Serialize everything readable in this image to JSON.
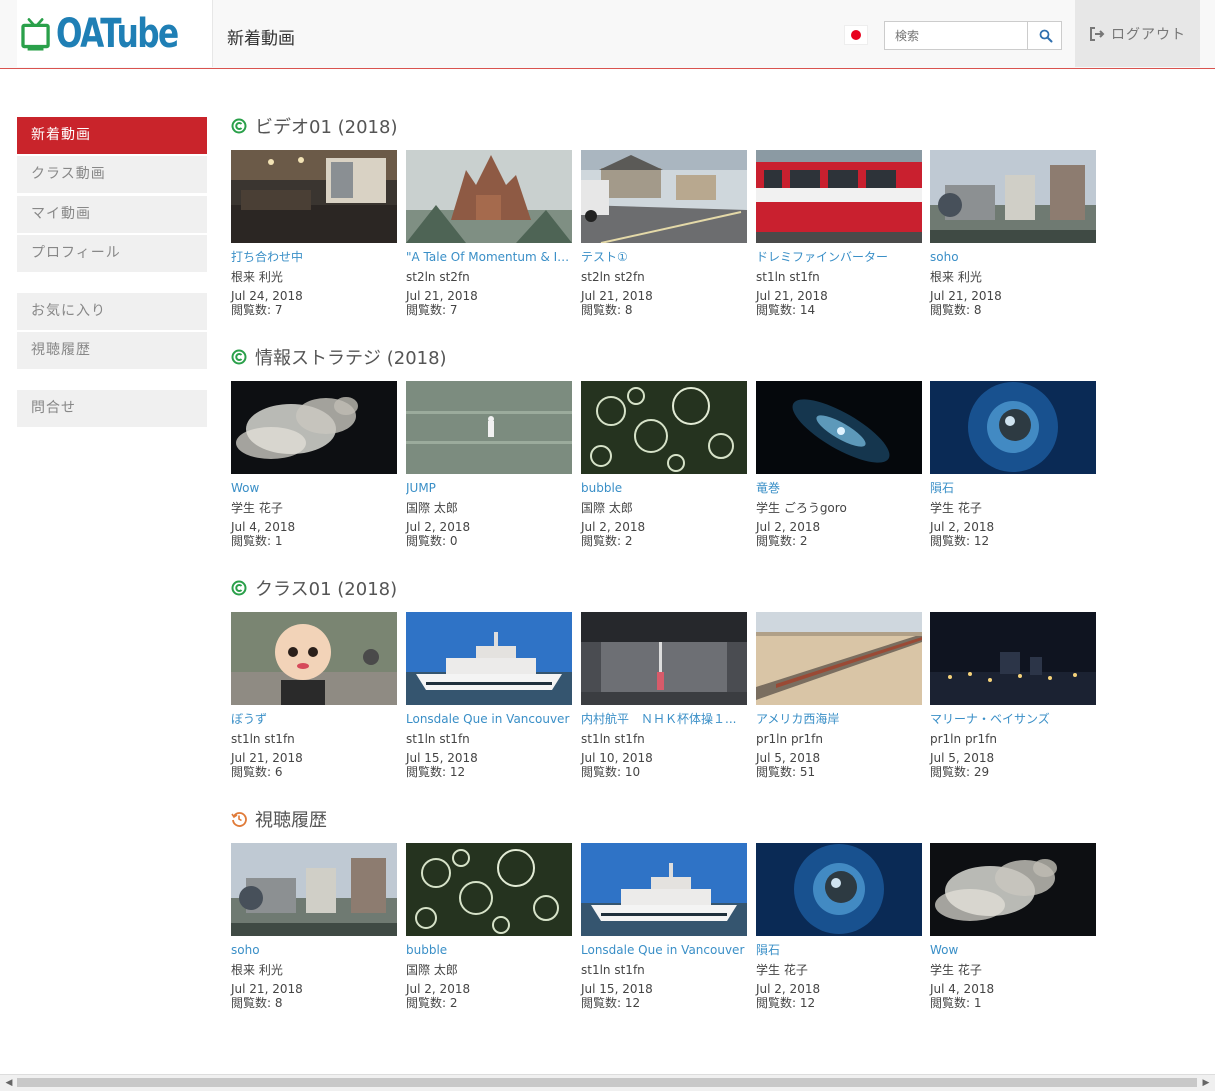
{
  "header": {
    "logo_text": "OATube",
    "page_title": "新着動画",
    "search_placeholder": "検索",
    "logout_label": "ログアウト"
  },
  "sidebar": {
    "group1": [
      "新着動画",
      "クラス動画",
      "マイ動画",
      "プロフィール"
    ],
    "group2": [
      "お気に入り",
      "視聴履歴"
    ],
    "group3": [
      "問合せ"
    ]
  },
  "sections": [
    {
      "title": "ビデオ01 (2018)",
      "icon": "copyright-circle-icon",
      "videos": [
        {
          "title": "打ち合わせ中",
          "author": "根来 利光",
          "date": "Jul 24, 2018",
          "views": "閲覧数: 7",
          "thumb": "cafe-interior"
        },
        {
          "title": "\"A Tale Of Momentum & In...",
          "author": "st2ln st2fn",
          "date": "Jul 21, 2018",
          "views": "閲覧数: 7",
          "thumb": "castle"
        },
        {
          "title": "テスト①",
          "author": "st2ln st2fn",
          "date": "Jul 21, 2018",
          "views": "閲覧数: 8",
          "thumb": "street"
        },
        {
          "title": "ドレミファインバーター",
          "author": "st1ln st1fn",
          "date": "Jul 21, 2018",
          "views": "閲覧数: 14",
          "thumb": "red-train"
        },
        {
          "title": "soho",
          "author": "根来 利光",
          "date": "Jul 21, 2018",
          "views": "閲覧数: 8",
          "thumb": "buildings"
        }
      ]
    },
    {
      "title": "情報ストラテジ (2018)",
      "icon": "copyright-circle-icon",
      "videos": [
        {
          "title": "Wow",
          "author": "学生 花子",
          "date": "Jul 4, 2018",
          "views": "閲覧数: 1",
          "thumb": "smoke"
        },
        {
          "title": "JUMP",
          "author": "国際 太郎",
          "date": "Jul 2, 2018",
          "views": "閲覧数: 0",
          "thumb": "water"
        },
        {
          "title": "bubble",
          "author": "国際 太郎",
          "date": "Jul 2, 2018",
          "views": "閲覧数: 2",
          "thumb": "bubbles"
        },
        {
          "title": "竜巻",
          "author": "学生 ごろうgoro",
          "date": "Jul 2, 2018",
          "views": "閲覧数: 2",
          "thumb": "vortex"
        },
        {
          "title": "隕石",
          "author": "学生 花子",
          "date": "Jul 2, 2018",
          "views": "閲覧数: 12",
          "thumb": "meteor"
        }
      ]
    },
    {
      "title": "クラス01 (2018)",
      "icon": "copyright-circle-icon",
      "videos": [
        {
          "title": "ぼうず",
          "author": "st1ln st1fn",
          "date": "Jul 21, 2018",
          "views": "閲覧数: 6",
          "thumb": "mascot"
        },
        {
          "title": "Lonsdale Que in Vancouver",
          "author": "st1ln st1fn",
          "date": "Jul 15, 2018",
          "views": "閲覧数: 12",
          "thumb": "yacht"
        },
        {
          "title": "内村航平　ＮＨＫ杯体操１...",
          "author": "st1ln st1fn",
          "date": "Jul 10, 2018",
          "views": "閲覧数: 10",
          "thumb": "gym"
        },
        {
          "title": "アメリカ西海岸",
          "author": "pr1ln pr1fn",
          "date": "Jul 5, 2018",
          "views": "閲覧数: 51",
          "thumb": "desert-train"
        },
        {
          "title": "マリーナ・ベイサンズ",
          "author": "pr1ln pr1fn",
          "date": "Jul 5, 2018",
          "views": "閲覧数: 29",
          "thumb": "night-city"
        }
      ]
    },
    {
      "title": "視聴履歴",
      "icon": "history-clock-icon",
      "videos": [
        {
          "title": "soho",
          "author": "根来 利光",
          "date": "Jul 21, 2018",
          "views": "閲覧数: 8",
          "thumb": "buildings"
        },
        {
          "title": "bubble",
          "author": "国際 太郎",
          "date": "Jul 2, 2018",
          "views": "閲覧数: 2",
          "thumb": "bubbles"
        },
        {
          "title": "Lonsdale Que in Vancouver",
          "author": "st1ln st1fn",
          "date": "Jul 15, 2018",
          "views": "閲覧数: 12",
          "thumb": "yacht"
        },
        {
          "title": "隕石",
          "author": "学生 花子",
          "date": "Jul 2, 2018",
          "views": "閲覧数: 12",
          "thumb": "meteor"
        },
        {
          "title": "Wow",
          "author": "学生 花子",
          "date": "Jul 4, 2018",
          "views": "閲覧数: 1",
          "thumb": "smoke"
        }
      ]
    }
  ],
  "colors": {
    "accent": "#c9242b",
    "link": "#3a8fc7",
    "section_icon": "#2aa04a",
    "history_icon": "#e07b39"
  }
}
